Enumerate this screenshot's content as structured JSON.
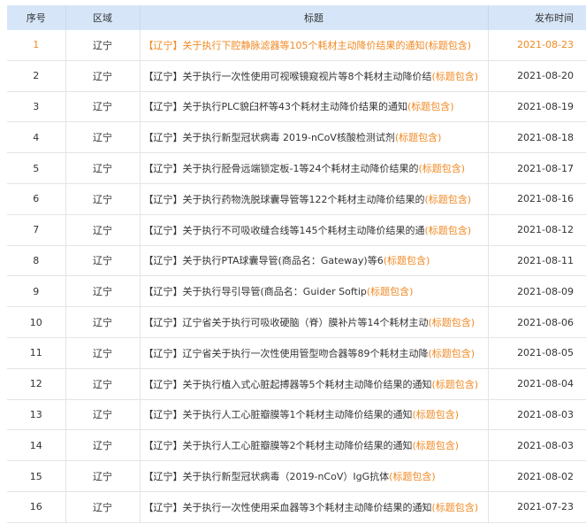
{
  "headers": {
    "num": "序号",
    "region": "区域",
    "title": "标题",
    "date": "发布时间"
  },
  "rows": [
    {
      "num": "1",
      "region": "辽宁",
      "title": "【辽宁】关于执行下腔静脉滤器等105个耗材主动降价结果的通知",
      "tag": "(标题包含)",
      "date": "2021-08-23"
    },
    {
      "num": "2",
      "region": "辽宁",
      "title": "【辽宁】关于执行一次性使用可视喉镜窥视片等8个耗材主动降价结",
      "tag": "(标题包含)",
      "date": "2021-08-20"
    },
    {
      "num": "3",
      "region": "辽宁",
      "title": "【辽宁】关于执行PLC貌臼杯等43个耗材主动降价结果的通知",
      "tag": "(标题包含)",
      "date": "2021-08-19"
    },
    {
      "num": "4",
      "region": "辽宁",
      "title": "【辽宁】关于执行新型冠状病毒 2019-nCoV核酸检测试剂",
      "tag": "(标题包含)",
      "date": "2021-08-18"
    },
    {
      "num": "5",
      "region": "辽宁",
      "title": "【辽宁】关于执行胫骨远端锁定板-1等24个耗材主动降价结果的",
      "tag": "(标题包含)",
      "date": "2021-08-17"
    },
    {
      "num": "6",
      "region": "辽宁",
      "title": "【辽宁】关于执行药物洗脱球囊导管等122个耗材主动降价结果的",
      "tag": "(标题包含)",
      "date": "2021-08-16"
    },
    {
      "num": "7",
      "region": "辽宁",
      "title": "【辽宁】关于执行不可吸收缝合线等145个耗材主动降价结果的通",
      "tag": "(标题包含)",
      "date": "2021-08-12"
    },
    {
      "num": "8",
      "region": "辽宁",
      "title": "【辽宁】关于执行PTA球囊导管(商品名：Gateway)等6",
      "tag": "(标题包含)",
      "date": "2021-08-11"
    },
    {
      "num": "9",
      "region": "辽宁",
      "title": "【辽宁】关于执行导引导管(商品名：Guider Softip",
      "tag": "(标题包含)",
      "date": "2021-08-09"
    },
    {
      "num": "10",
      "region": "辽宁",
      "title": "【辽宁】辽宁省关于执行可吸收硬脑（脊）膜补片等14个耗材主动",
      "tag": "(标题包含)",
      "date": "2021-08-06"
    },
    {
      "num": "11",
      "region": "辽宁",
      "title": "【辽宁】辽宁省关于执行一次性使用管型吻合器等89个耗材主动降",
      "tag": "(标题包含)",
      "date": "2021-08-05"
    },
    {
      "num": "12",
      "region": "辽宁",
      "title": "【辽宁】关于执行植入式心脏起搏器等5个耗材主动降价结果的通知",
      "tag": "(标题包含)",
      "date": "2021-08-04"
    },
    {
      "num": "13",
      "region": "辽宁",
      "title": "【辽宁】关于执行人工心脏瓣膜等1个耗材主动降价结果的通知",
      "tag": "(标题包含)",
      "date": "2021-08-03"
    },
    {
      "num": "14",
      "region": "辽宁",
      "title": "【辽宁】关于执行人工心脏瓣膜等2个耗材主动降价结果的通知",
      "tag": "(标题包含)",
      "date": "2021-08-03"
    },
    {
      "num": "15",
      "region": "辽宁",
      "title": "【辽宁】关于执行新型冠状病毒（2019-nCoV）IgG抗体",
      "tag": "(标题包含)",
      "date": "2021-08-02"
    },
    {
      "num": "16",
      "region": "辽宁",
      "title": "【辽宁】关于执行一次性使用采血器等3个耗材主动降价结果的通知",
      "tag": "(标题包含)",
      "date": "2021-07-23"
    }
  ]
}
